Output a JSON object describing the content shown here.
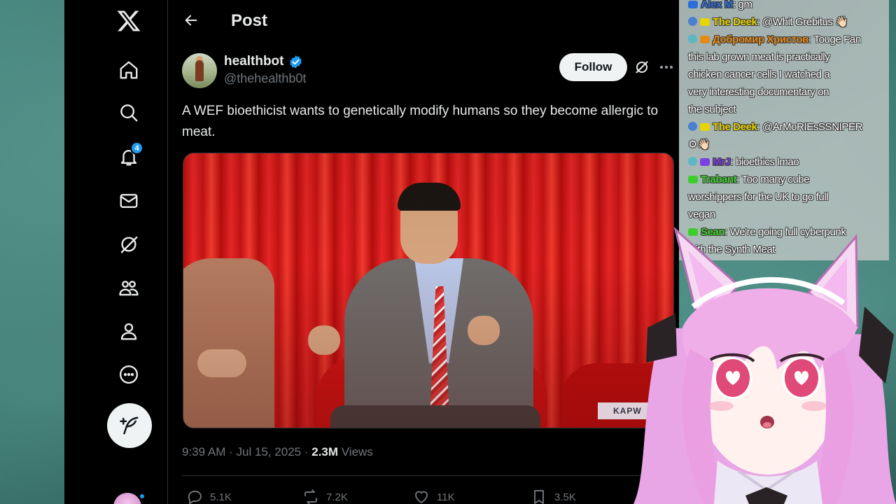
{
  "sidebar": {
    "notification_count": "4"
  },
  "header": {
    "title": "Post"
  },
  "post": {
    "author_name": "healthbot",
    "author_handle": "@thehealthb0t",
    "follow_label": "Follow",
    "text": "A WEF bioethicist wants to genetically modify humans so they become allergic to meat.",
    "media_watermark": "KAPW",
    "time": "9:39 AM",
    "date": "Jul 15, 2025",
    "views_count": "2.3M",
    "views_label": "Views",
    "replies": "5.1K",
    "reposts": "7.2K",
    "likes": "11K",
    "bookmarks": "3.5K"
  },
  "chat": {
    "messages": [
      {
        "user": "Alex M",
        "text": "gm",
        "color": "#2c6fd8"
      },
      {
        "user": "The Deek",
        "text": "@Whit Grebitus 👋🏻",
        "color": "#e8d400"
      },
      {
        "user": "Добромир Христов",
        "text": "Touge Fan",
        "color": "#e38a18"
      },
      {
        "text": "this lab grown meat is practically"
      },
      {
        "text": "chicken cancer cells I watched a"
      },
      {
        "text": "very interesting documentary on"
      },
      {
        "text": "the subject"
      },
      {
        "user": "The Deek",
        "text": "@ArMoRIEsSSNIPER",
        "color": "#e8d400"
      },
      {
        "text": "⚙👋🏻"
      },
      {
        "user": "MrJ",
        "text": "bioethics lmao",
        "color": "#7c3fe0"
      },
      {
        "user": "Trabant",
        "text": "Too many cube",
        "color": "#3ccf2c"
      },
      {
        "text": "worshippers for the UK to go full"
      },
      {
        "text": "vegan"
      },
      {
        "user": "Sean",
        "text": "We're going full cyberpunk",
        "color": "#3ccf2c"
      },
      {
        "text": "with the Synth Meat"
      }
    ]
  }
}
